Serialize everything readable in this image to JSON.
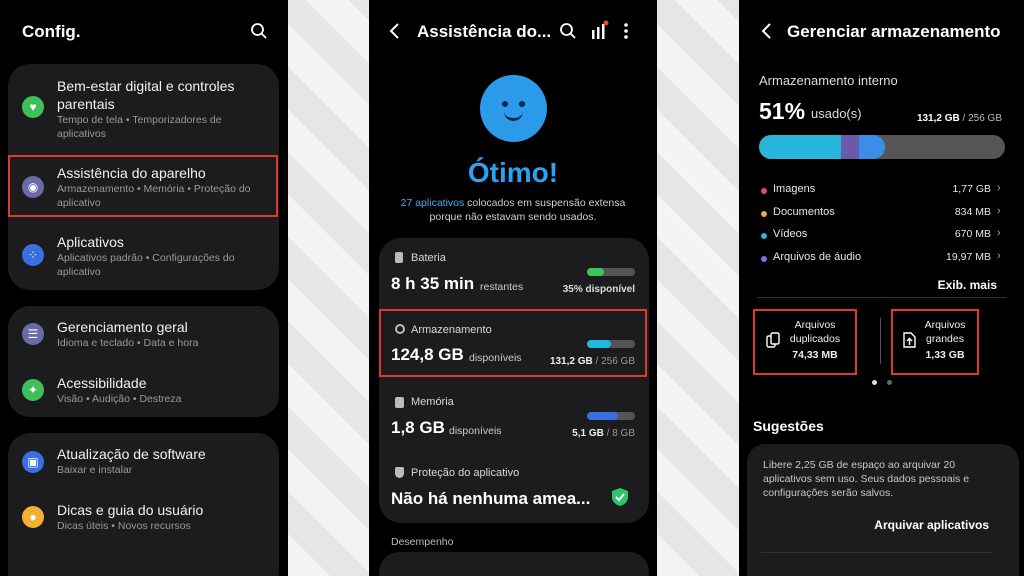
{
  "settings": {
    "title": "Config.",
    "groups": [
      {
        "items": [
          {
            "title": "Bem-estar digital e controles parentais",
            "sub": "Tempo de tela  •  Temporizadores de aplicativos",
            "color": "#3fbf5a"
          },
          {
            "title": "Assistência do aparelho",
            "sub": "Armazenamento  •  Memória  •  Proteção do aplicativo",
            "color": "#6a6aa8"
          },
          {
            "title": "Aplicativos",
            "sub": "Aplicativos padrão  •  Configurações do aplicativo",
            "color": "#3a6fe0"
          }
        ]
      },
      {
        "items": [
          {
            "title": "Gerenciamento geral",
            "sub": "Idioma e teclado  •  Data e hora",
            "color": "#6a6aa8"
          },
          {
            "title": "Acessibilidade",
            "sub": "Visão  •  Audição  •  Destreza",
            "color": "#3fbf5a"
          }
        ]
      },
      {
        "items": [
          {
            "title": "Atualização de software",
            "sub": "Baixar e instalar",
            "color": "#3a6fe0"
          },
          {
            "title": "Dicas e guia do usuário",
            "sub": "Dicas úteis  •  Novos recursos",
            "color": "#f0b030"
          }
        ]
      }
    ]
  },
  "care": {
    "title": "Assistência do...",
    "status": "Ótimo!",
    "note_link": "27 aplicativos",
    "note_rest": " colocados em suspensão extensa porque não estavam sendo usados.",
    "battery": {
      "label": "Bateria",
      "value": "8 h 35 min",
      "suffix": "restantes",
      "right": "35% disponível",
      "level": 0.35,
      "color": "#3fc85a"
    },
    "storage": {
      "label": "Armazenamento",
      "value": "124,8 GB",
      "suffix": "disponíveis",
      "used": "131,2 GB",
      "total": "/ 256 GB",
      "level": 0.51,
      "color": "#25b8e0"
    },
    "memory": {
      "label": "Memória",
      "value": "1,8 GB",
      "suffix": "disponíveis",
      "used": "5,1 GB",
      "total": "/ 8 GB",
      "level": 0.64,
      "color": "#3a6fe0"
    },
    "protection": {
      "label": "Proteção do aplicativo",
      "value": "Não há nenhuma amea..."
    },
    "performance": "Desempenho"
  },
  "storage": {
    "title": "Gerenciar armazenamento",
    "internal": "Armazenamento interno",
    "percent": "51%",
    "used_label": "usado(s)",
    "used": "131,2 GB",
    "total": "/ 256 GB",
    "categories": [
      {
        "name": "Imagens",
        "value": "1,77 GB",
        "color": "#e84a6a"
      },
      {
        "name": "Documentos",
        "value": "834 MB",
        "color": "#e8a84a"
      },
      {
        "name": "Vídeos",
        "value": "670 MB",
        "color": "#25b8e0"
      },
      {
        "name": "Arquivos de áudio",
        "value": "19,97 MB",
        "color": "#8a6ae0"
      }
    ],
    "more": "Exib. mais",
    "duplicates": {
      "line1": "Arquivos",
      "line2": "duplicados",
      "value": "74,33 MB"
    },
    "large": {
      "line1": "Arquivos",
      "line2": "grandes",
      "value": "1,33 GB"
    },
    "suggestions": "Sugestões",
    "suggestion_text": "Libere 2,25 GB de espaço ao arquivar 20 aplicativos sem uso. Seus dados pessoais e configurações serão salvos.",
    "archive_button": "Arquivar aplicativos"
  }
}
